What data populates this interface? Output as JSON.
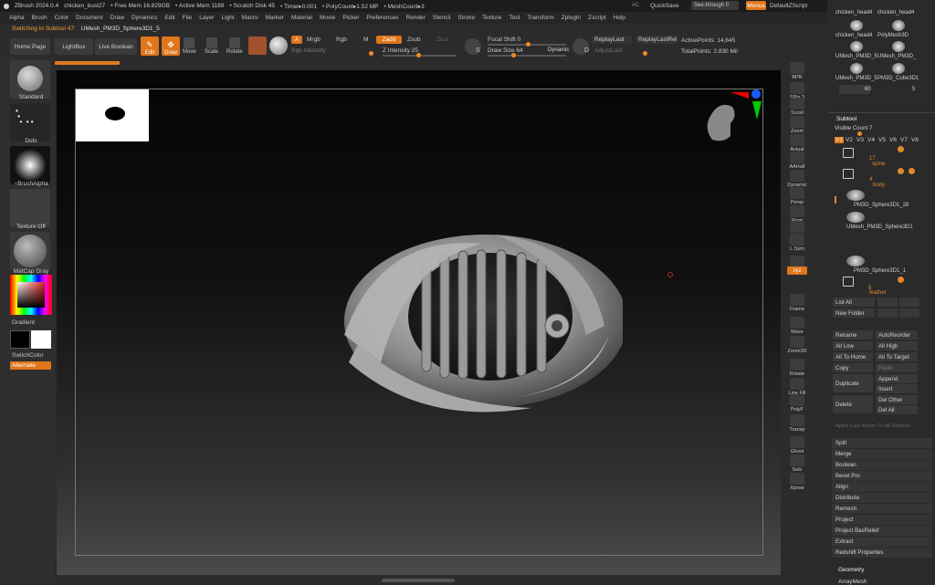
{
  "titlebar": {
    "app": "ZBrush 2024.0.4",
    "file": "chicken_bust27",
    "free_mem": "• Free Mem 16.829GB",
    "active_mem": "• Active Mem 1189",
    "scratch": "• Scratch Disk 45",
    "timer": "• Timer▸0.001",
    "polycount": "• PolyCount▸1.52 MP",
    "meshcount": "• MeshCount▸3",
    "ac": "AC",
    "quicksave": "QuickSave",
    "seethrough": "See-through  0",
    "menus": "Menus",
    "script": "DefaultZScript"
  },
  "menubar": [
    "Alpha",
    "Brush",
    "Color",
    "Document",
    "Draw",
    "Dynamics",
    "Edit",
    "File",
    "Layer",
    "Light",
    "Macro",
    "Marker",
    "Material",
    "Movie",
    "Picker",
    "Preferences",
    "Render",
    "Stencil",
    "Stroke",
    "Texture",
    "Tool",
    "Transform",
    "Zplugin",
    "Zscript",
    "Help"
  ],
  "status": {
    "switching": "Switching to Subtool 47:",
    "subtool": "UMesh_PM3D_Sphere3D1_5"
  },
  "toolbar": {
    "home": "Home Page",
    "lightbox": "LightBox",
    "liveboolean": "Live Boolean",
    "edit": "Edit",
    "draw": "Draw",
    "move": "Move",
    "scale": "Scale",
    "rotate": "Rotate",
    "a": "A",
    "mrgb": "Mrgb",
    "rgb": "Rgb",
    "m": "M",
    "zadd": "Zadd",
    "zsub": "Zsub",
    "zcut": "Zcut",
    "rgbint": "Rgb Intensity",
    "zint": "Z Intensity 25",
    "focal": "Focal Shift 0",
    "drawsize": "Draw Size 64",
    "dynamic": "Dynamic",
    "replay": "ReplayLast",
    "replayrel": "ReplayLastRel",
    "adjust": "AdjustLast",
    "activepoints": "ActivePoints: 14,645",
    "totalpoints": "TotalPoints: 2.830 Mil",
    "s": "S",
    "d": "D"
  },
  "left": {
    "standard": "Standard",
    "dots": "Dots",
    "brushalpha": "~BrushAlpha",
    "texture": "Texture Off",
    "matcap": "MatCap Gray",
    "gradient": "Gradient",
    "switchcolor": "SwitchColor",
    "alternate": "Alternate"
  },
  "rightstrip": [
    "BPR",
    "SPix 3",
    "Scroll",
    "Zoom",
    "Actual",
    "AAHalf",
    "Dynamic",
    "Persp",
    "Floor",
    "Local",
    "L.Sym",
    "Gizmo",
    "xyz",
    "Frame",
    "Move",
    "Zoom3D",
    "Rotate",
    "Line Fill",
    "PolyF",
    "Transp",
    "Ghost",
    "Solo",
    "Xpose"
  ],
  "panel": {
    "tools": [
      "chicken_head4",
      "chicken_head4",
      "chicken_head4",
      "PolyMesh3D",
      "UMesh_PM3D_5",
      "UMesh_PM3D_",
      "UMesh_PM3D_5",
      "PM3D_Cube3D1"
    ],
    "count3": "3",
    "count60": "60",
    "count5": "5",
    "subtool": "Subtool",
    "visiblecount": "Visible Count 7",
    "versions": [
      "V1",
      "V2",
      "V3",
      "V4",
      "V5",
      "V6",
      "V7",
      "V8"
    ],
    "folder1_count": "17",
    "folder1": "spine",
    "folder2_count": "4",
    "folder2": "body",
    "items": [
      "PM3D_Sphere3D1_28",
      "UMesh_PM3D_Sphere3D1",
      "PM3D_Sphere3D1_1"
    ],
    "folder3_count": "5",
    "folder3": "feather",
    "listall": "List All",
    "newfolder": "New Folder",
    "rename": "Rename",
    "autoreorder": "AutoReorder",
    "alllow": "All Low",
    "allhigh": "All High",
    "alltohome": "All To Home",
    "alltotarget": "All To Target",
    "copy": "Copy",
    "paste": "Paste",
    "duplicate": "Duplicate",
    "append": "Append",
    "insert": "Insert",
    "delete": "Delete",
    "delother": "Del Other",
    "delall": "Del All",
    "applylast": "Apply Last Action To All Subtool",
    "sections": [
      "Split",
      "Merge",
      "Boolean",
      "Bevel Pro",
      "Align",
      "Distribute",
      "Remesh",
      "Project",
      "Project BasRelief",
      "Extract",
      "Redshift Properties"
    ],
    "geometry": "Geometry",
    "arraymesh": "ArrayMesh"
  }
}
